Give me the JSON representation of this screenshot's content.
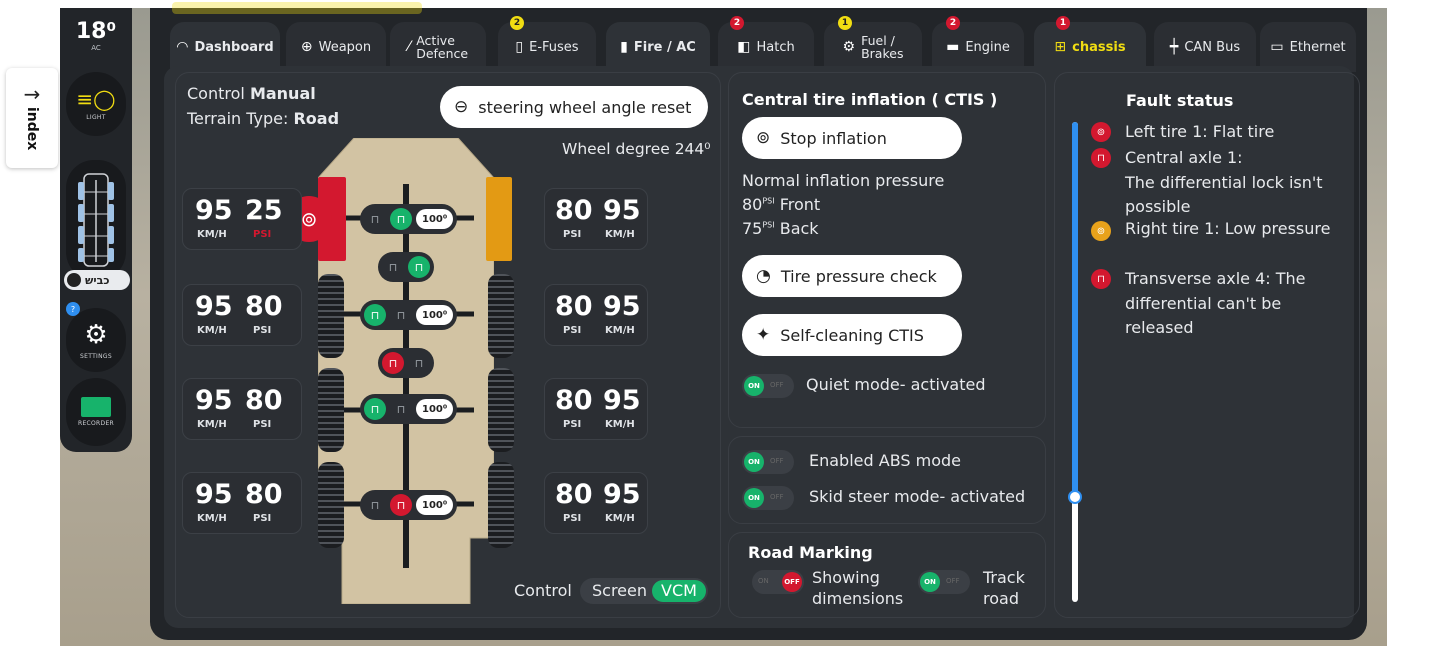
{
  "side_tab": {
    "arrow": "→",
    "label": "index"
  },
  "rail": {
    "temperature": "18⁰",
    "temperature_unit": "AC",
    "light_caption": "LIGHT",
    "hebrew_toggle": "כביש",
    "settings_caption": "SETTINGS",
    "settings_badge": "?",
    "recorder_caption": "RECORDER"
  },
  "tabs": [
    {
      "label": "Dashboard",
      "icon": "gauge-icon",
      "badge": ""
    },
    {
      "label": "Weapon",
      "icon": "crosshair-icon",
      "badge": ""
    },
    {
      "label": "Active\nDefence",
      "icon": "shield-icon",
      "badge": ""
    },
    {
      "label": "E-Fuses",
      "icon": "fuse-icon",
      "badge": "2"
    },
    {
      "label": "Fire / AC",
      "icon": "fire-icon",
      "badge": ""
    },
    {
      "label": "Hatch",
      "icon": "hatch-icon",
      "badge": "2"
    },
    {
      "label": "Fuel /\nBrakes",
      "icon": "fuel-icon",
      "badge": "1"
    },
    {
      "label": "Engine",
      "icon": "engine-icon",
      "badge": "2"
    },
    {
      "label": "chassis",
      "icon": "chassis-icon",
      "badge": "1"
    },
    {
      "label": "CAN Bus",
      "icon": "network-icon",
      "badge": ""
    },
    {
      "label": "Ethernet",
      "icon": "ethernet-icon",
      "badge": ""
    }
  ],
  "chassis": {
    "control_label": "Control",
    "control_value": "Manual",
    "terrain_label": "Terrain Type:",
    "terrain_value": "Road",
    "steering_reset": "steering wheel angle reset",
    "wheel_degree": "Wheel degree 244⁰",
    "control_bottom": "Control",
    "screen_label": "Screen",
    "vcm_label": "VCM",
    "left_readouts": [
      {
        "speed": "95",
        "speed_unit": "KM/H",
        "pressure": "25",
        "pressure_unit": "PSI",
        "alert": true
      },
      {
        "speed": "95",
        "speed_unit": "KM/H",
        "pressure": "80",
        "pressure_unit": "PSI",
        "alert": false
      },
      {
        "speed": "95",
        "speed_unit": "KM/H",
        "pressure": "80",
        "pressure_unit": "PSI",
        "alert": false
      },
      {
        "speed": "95",
        "speed_unit": "KM/H",
        "pressure": "80",
        "pressure_unit": "PSI",
        "alert": false
      }
    ],
    "right_readouts": [
      {
        "pressure": "80",
        "pressure_unit": "PSI",
        "speed": "95",
        "speed_unit": "KM/H"
      },
      {
        "pressure": "80",
        "pressure_unit": "PSI",
        "speed": "95",
        "speed_unit": "KM/H"
      },
      {
        "pressure": "80",
        "pressure_unit": "PSI",
        "speed": "95",
        "speed_unit": "KM/H"
      },
      {
        "pressure": "80",
        "pressure_unit": "PSI",
        "speed": "95",
        "speed_unit": "KM/H"
      }
    ],
    "axle_degrees": [
      "100⁰",
      "100⁰",
      "100⁰",
      "100⁰"
    ]
  },
  "ctis": {
    "title": "Central tire inflation ( CTIS )",
    "stop_inflation": "Stop inflation",
    "normal_pressure": "Normal inflation pressure",
    "front_value": "80",
    "front_unit": "PSI",
    "front_label": "Front",
    "back_value": "75",
    "back_unit": "PSI",
    "back_label": "Back",
    "pressure_check": "Tire pressure check",
    "self_cleaning": "Self-cleaning CTIS",
    "quiet_mode": "Quiet mode- activated",
    "abs_mode": "Enabled ABS mode",
    "skid_mode": "Skid steer mode- activated",
    "road_marking_title": "Road Marking",
    "showing_dimensions": "Showing\ndimensions",
    "track_road": "Track\nroad",
    "on": "ON",
    "off": "OFF"
  },
  "faults": {
    "title": "Fault status",
    "items": [
      {
        "text": "Left tire 1: Flat tire",
        "color": "#d3182f",
        "icon": "tire-icon"
      },
      {
        "text": "Central axle 1:\nThe differential lock isn't\npossible",
        "color": "#d3182f",
        "icon": "unlock-icon"
      },
      {
        "text": "Right tire 1: Low pressure",
        "color": "#e8a21b",
        "icon": "tire-icon"
      },
      {
        "text": "Transverse axle 4: The\ndifferential can't be\nreleased",
        "color": "#d3182f",
        "icon": "lock-icon"
      }
    ]
  },
  "colors": {
    "accent_green": "#17b36b",
    "alert_red": "#d3182f",
    "warning_orange": "#e39a14",
    "slider_blue": "#2f8ff0",
    "chassis_tab_yellow": "#f1dd12"
  }
}
